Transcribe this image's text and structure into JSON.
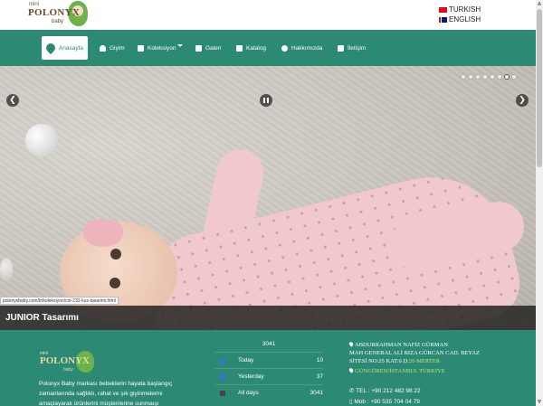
{
  "header": {
    "logo": {
      "mini": "mini",
      "brand": "POLONYX",
      "sub": "baby"
    },
    "languages": [
      {
        "label": "TURKISH",
        "flag": "turkey-flag-icon"
      },
      {
        "label": "ENGLISH",
        "flag": "uk-flag-icon"
      }
    ]
  },
  "nav": {
    "items": [
      {
        "label": "Anasayfa",
        "icon": "home-pin-icon",
        "active": true
      },
      {
        "label": "Giyim",
        "icon": "person-icon"
      },
      {
        "label": "Koleksiyon",
        "icon": "shirt-icon",
        "has_dropdown": true
      },
      {
        "label": "Galeri",
        "icon": "image-icon"
      },
      {
        "label": "Katalog",
        "icon": "book-icon"
      },
      {
        "label": "Hakkımızda",
        "icon": "user-icon"
      },
      {
        "label": "İletişim",
        "icon": "phone-icon"
      }
    ]
  },
  "slider": {
    "prev": "❮",
    "next": "❯",
    "dots_count": 8,
    "active_dot": 6,
    "url_tooltip": "polonyxbaby.com/tr/koleksiyon/col-232-kus-tasarimi.html",
    "caption": "JUNIOR Tasarımı"
  },
  "footer": {
    "logo": {
      "mini": "mini",
      "brand": "POLONYX",
      "sub": "baby"
    },
    "about": "Polonyx Baby markası bebeklerin hayata başlangıç zamanlarında sağlıklı, rahat ve şık giyinmelerini amaçlayarak ürünlerini müşterilerine sunmaışı",
    "stats": {
      "total": "3041",
      "rows": [
        {
          "label": "Today",
          "value": "10",
          "icon": "pin-icon"
        },
        {
          "label": "Yesterday",
          "value": "37",
          "icon": "calendar-icon"
        },
        {
          "label": "All days",
          "value": "3041",
          "icon": "grid-icon"
        }
      ]
    },
    "contact": {
      "name": "ABDURRAHMAN NAFİZ GÜRMAN",
      "street": "MAH GENERAL ALİ RIZA GÜRCAN CAD. BEYAZ",
      "site": "SİTESİ NO:25 KAT:6 D:",
      "site_highlight": "26 MERTER",
      "district": "GÜNGÖREN/İSTANBUL TÜRKİYE",
      "tel": "TEL : +90 212 482 98 22",
      "mob": "Mob : +90 535 704 04 79"
    }
  }
}
